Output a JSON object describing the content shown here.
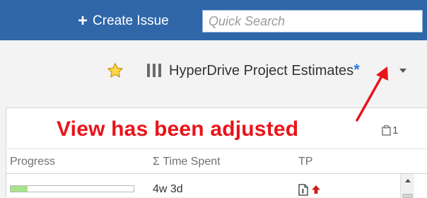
{
  "header": {
    "create_label": "Create Issue",
    "search_placeholder": "Quick Search"
  },
  "filter": {
    "title": "HyperDrive Project Estimates",
    "modified_mark": "*"
  },
  "annotation": {
    "text": "View has been adjusted"
  },
  "panel": {
    "column_count": "1",
    "columns": [
      "Progress",
      "Σ Time Spent",
      "TP"
    ],
    "rows": [
      {
        "progress": 0.14,
        "time_spent": "4w 3d"
      }
    ]
  },
  "colors": {
    "header_bg": "#2f67a9",
    "annotation": "#e9141a",
    "modified_mark": "#2e7ce0",
    "progress_fill": "#a7e38a"
  },
  "icons": [
    "plus-icon",
    "star-icon",
    "view-columns-icon",
    "chevron-down-icon",
    "column-picker-icon",
    "document-icon",
    "priority-up-icon",
    "scroll-up-icon"
  ]
}
